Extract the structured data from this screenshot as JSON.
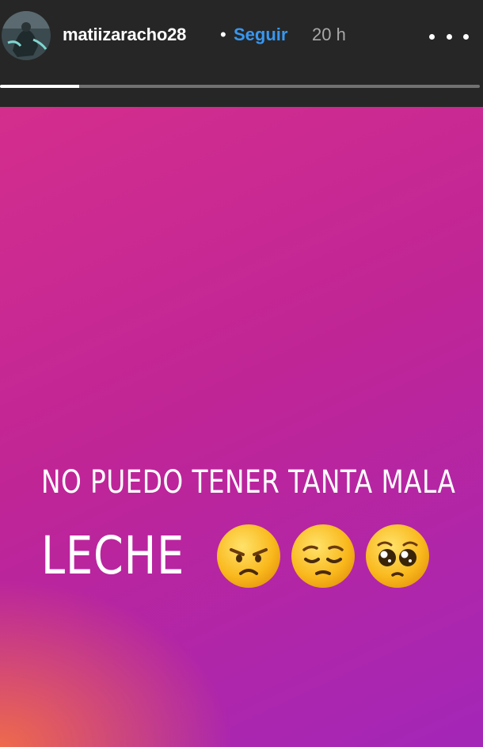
{
  "header": {
    "username": "matiizaracho28",
    "separator": "•",
    "follow_label": "Seguir",
    "time_ago": "20 h",
    "progress": 0.165
  },
  "story": {
    "line1": "NO PUEDO TENER TANTA MALA",
    "line2": "LECHE",
    "emojis": [
      "angry-face",
      "pensive-face",
      "pleading-face"
    ],
    "colors": {
      "gradient_top": "#d42e8d",
      "gradient_right": "#a326b8",
      "gradient_bottom_left": "#f26e46",
      "follow_blue": "#3897f0"
    }
  }
}
